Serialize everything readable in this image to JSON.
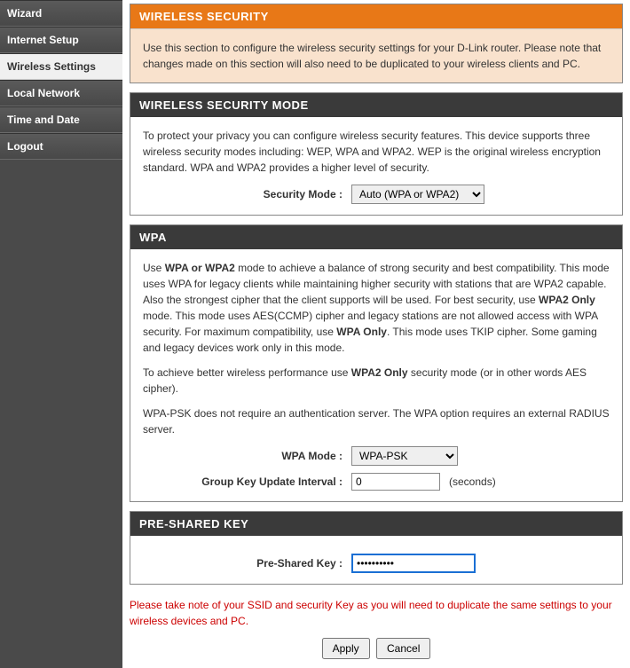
{
  "sidebar": {
    "items": [
      {
        "label": "Wizard"
      },
      {
        "label": "Internet Setup"
      },
      {
        "label": "Wireless Settings"
      },
      {
        "label": "Local Network"
      },
      {
        "label": "Time and Date"
      },
      {
        "label": "Logout"
      }
    ]
  },
  "sections": {
    "ws": {
      "title": "WIRELESS SECURITY",
      "desc": "Use this section to configure the wireless security settings for your D-Link router. Please note that changes made on this section will also need to be duplicated to your wireless clients and PC."
    },
    "mode": {
      "title": "WIRELESS SECURITY MODE",
      "desc": "To protect your privacy you can configure wireless security features. This device supports three wireless security modes including: WEP, WPA and WPA2. WEP is the original wireless encryption standard. WPA and WPA2 provides a higher level of security.",
      "label": "Security Mode :",
      "value": "Auto (WPA or WPA2)"
    },
    "wpa": {
      "title": "WPA",
      "p1a": "Use ",
      "p1b": "WPA or WPA2",
      "p1c": " mode to achieve a balance of strong security and best compatibility. This mode uses WPA for legacy clients while maintaining higher security with stations that are WPA2 capable. Also the strongest cipher that the client supports will be used. For best security, use ",
      "p1d": "WPA2 Only",
      "p1e": " mode. This mode uses AES(CCMP) cipher and legacy stations are not allowed access with WPA security. For maximum compatibility, use ",
      "p1f": "WPA Only",
      "p1g": ". This mode uses TKIP cipher. Some gaming and legacy devices work only in this mode.",
      "p2a": "To achieve better wireless performance use ",
      "p2b": "WPA2 Only",
      "p2c": " security mode (or in other words AES cipher).",
      "p3": "WPA-PSK does not require an authentication server. The WPA option requires an external RADIUS server.",
      "wpamode_label": "WPA Mode :",
      "wpamode_value": "WPA-PSK",
      "gkui_label": "Group Key Update Interval :",
      "gkui_value": "0",
      "gkui_suffix": "(seconds)"
    },
    "psk": {
      "title": "PRE-SHARED KEY",
      "label": "Pre-Shared Key :",
      "value": "••••••••••"
    }
  },
  "warn": "Please take note of your SSID and security Key as you will need to duplicate the same settings to your wireless devices and PC.",
  "buttons": {
    "apply": "Apply",
    "cancel": "Cancel"
  }
}
